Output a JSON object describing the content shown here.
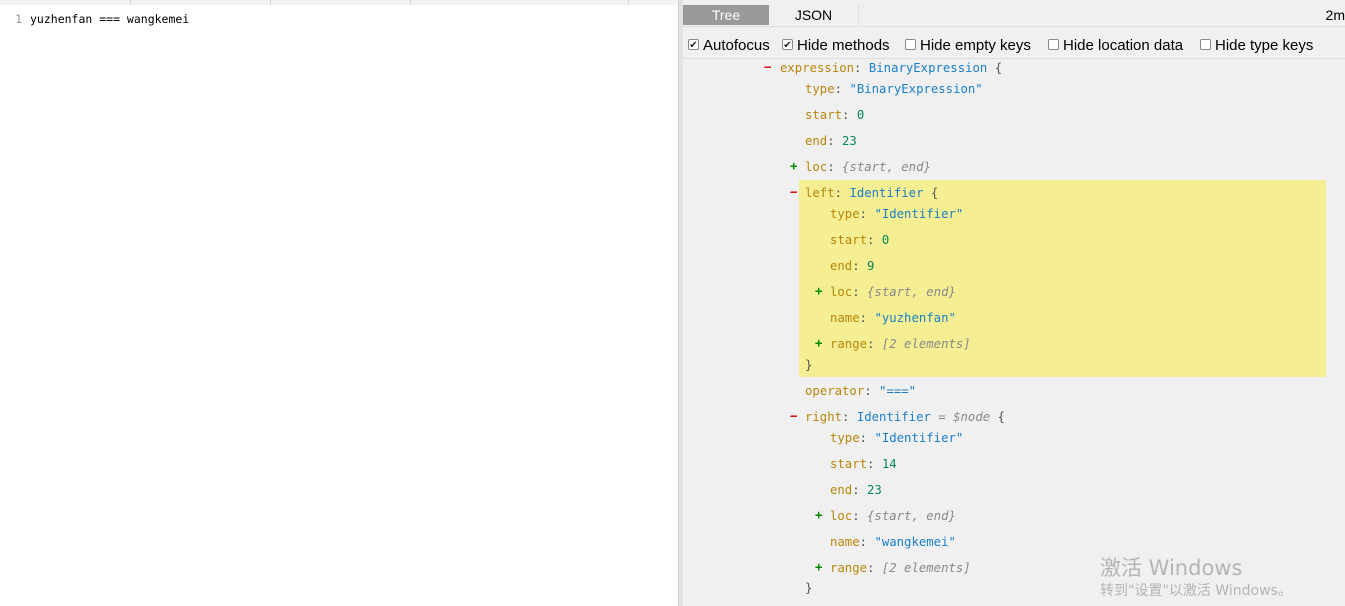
{
  "editor": {
    "line_number": "1",
    "code": "yuzhenfan === wangkemei"
  },
  "tabs": {
    "tree_label": "Tree",
    "json_label": "JSON",
    "active": "Tree"
  },
  "time_label": "2m",
  "options": [
    {
      "label": "Autofocus",
      "checked": true
    },
    {
      "label": "Hide methods",
      "checked": true
    },
    {
      "label": "Hide empty keys",
      "checked": false
    },
    {
      "label": "Hide location data",
      "checked": false
    },
    {
      "label": "Hide type keys",
      "checked": false
    }
  ],
  "tree": {
    "expression_key": "expression",
    "expression_type": "BinaryExpression",
    "expr_type_key": "type",
    "expr_type_value": "\"BinaryExpression\"",
    "expr_start_key": "start",
    "expr_start_value": "0",
    "expr_end_key": "end",
    "expr_end_value": "23",
    "expr_loc_key": "loc",
    "loc_summary": "{start, end}",
    "left_key": "left",
    "left_type": "Identifier",
    "left_type_key": "type",
    "left_type_value": "\"Identifier\"",
    "left_start_key": "start",
    "left_start_value": "0",
    "left_end_key": "end",
    "left_end_value": "9",
    "left_loc_key": "loc",
    "left_name_key": "name",
    "left_name_value": "\"yuzhenfan\"",
    "left_range_key": "range",
    "range_summary": "[2 elements]",
    "operator_key": "operator",
    "operator_value": "\"===\"",
    "right_key": "right",
    "right_type": "Identifier",
    "right_node_hint": "= $node",
    "right_type_key": "type",
    "right_type_value": "\"Identifier\"",
    "right_start_key": "start",
    "right_start_value": "14",
    "right_end_key": "end",
    "right_end_value": "23",
    "right_loc_key": "loc",
    "right_name_key": "name",
    "right_name_value": "\"wangkemei\"",
    "right_range_key": "range",
    "minus": "−",
    "plus": "+",
    "open_brace": "{",
    "close_brace": "}",
    "colon": ":"
  },
  "watermark": {
    "title": "激活 Windows",
    "subtitle": "转到\"设置\"以激活 Windows。"
  }
}
